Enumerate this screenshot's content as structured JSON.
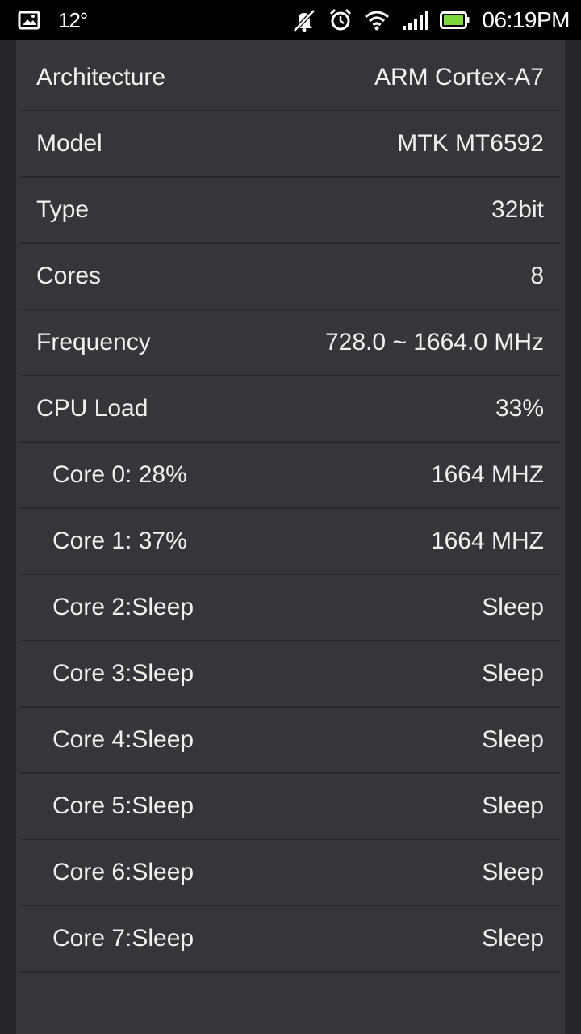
{
  "status_bar": {
    "temperature": "12°",
    "time": "06:19PM",
    "icons": [
      "gallery-icon",
      "notifications-muted-icon",
      "alarm-icon",
      "wifi-icon",
      "signal-icon",
      "battery-icon"
    ],
    "battery_color": "#7dd63c"
  },
  "cpu_info": {
    "rows": [
      {
        "label": "Architecture",
        "value": "ARM Cortex-A7"
      },
      {
        "label": "Model",
        "value": "MTK MT6592"
      },
      {
        "label": "Type",
        "value": "32bit"
      },
      {
        "label": "Cores",
        "value": "8"
      },
      {
        "label": "Frequency",
        "value": "728.0 ~ 1664.0 MHz"
      },
      {
        "label": "CPU Load",
        "value": "33%"
      }
    ],
    "cores": [
      {
        "label": "Core 0: 28%",
        "value": "1664 MHZ"
      },
      {
        "label": "Core 1: 37%",
        "value": "1664 MHZ"
      },
      {
        "label": "Core 2:Sleep",
        "value": "Sleep"
      },
      {
        "label": "Core 3:Sleep",
        "value": "Sleep"
      },
      {
        "label": "Core 4:Sleep",
        "value": "Sleep"
      },
      {
        "label": "Core 5:Sleep",
        "value": "Sleep"
      },
      {
        "label": "Core 6:Sleep",
        "value": "Sleep"
      },
      {
        "label": "Core 7:Sleep",
        "value": "Sleep"
      }
    ]
  }
}
